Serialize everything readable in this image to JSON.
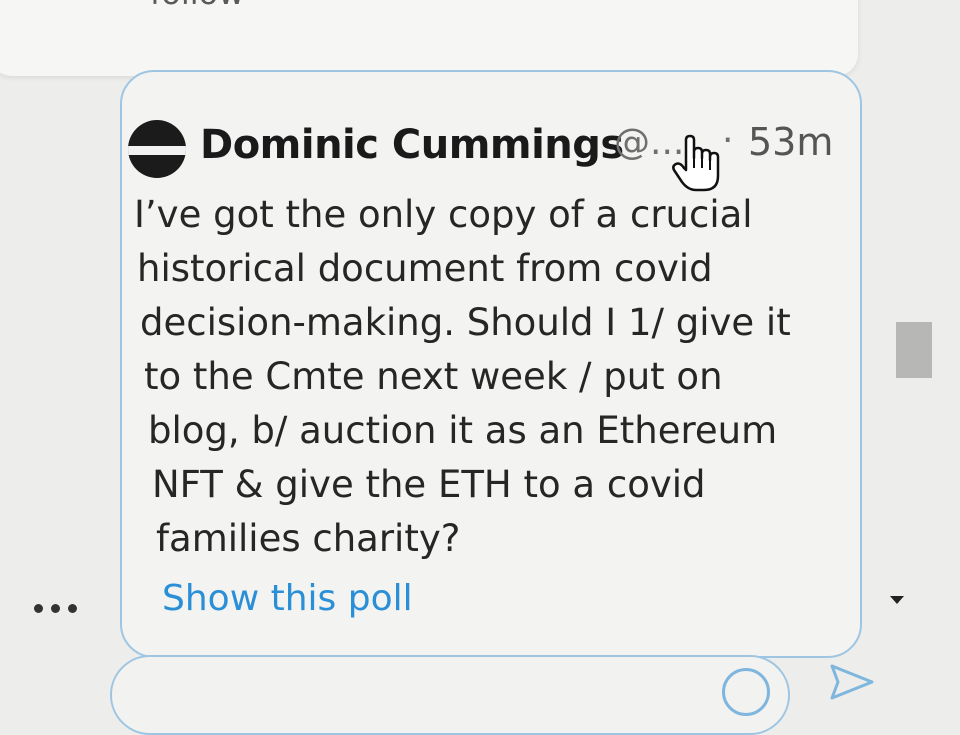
{
  "previous_tweet": {
    "action_text": "follow"
  },
  "quoted_tweet": {
    "author_name": "Dominic Cummings",
    "handle": "@...",
    "separator": "·",
    "time": "53m",
    "body_lines": [
      "I’ve got the only copy of a crucial",
      "historical document from covid",
      "decision-making. Should I 1/ give it",
      "to the Cmte next week / put on",
      "blog, b/ auction it as an Ethereum",
      "NFT & give the ETH to a covid",
      "families charity?"
    ],
    "poll_link": "Show this poll"
  },
  "icons": {
    "more": "more-options-icon",
    "cursor": "hand-pointer-cursor-icon",
    "emoji": "emoji-icon",
    "send": "send-icon",
    "scroll_down": "chevron-down-icon"
  },
  "colors": {
    "link_blue": "#2a8fd6",
    "card_border": "#9ec6e3"
  }
}
